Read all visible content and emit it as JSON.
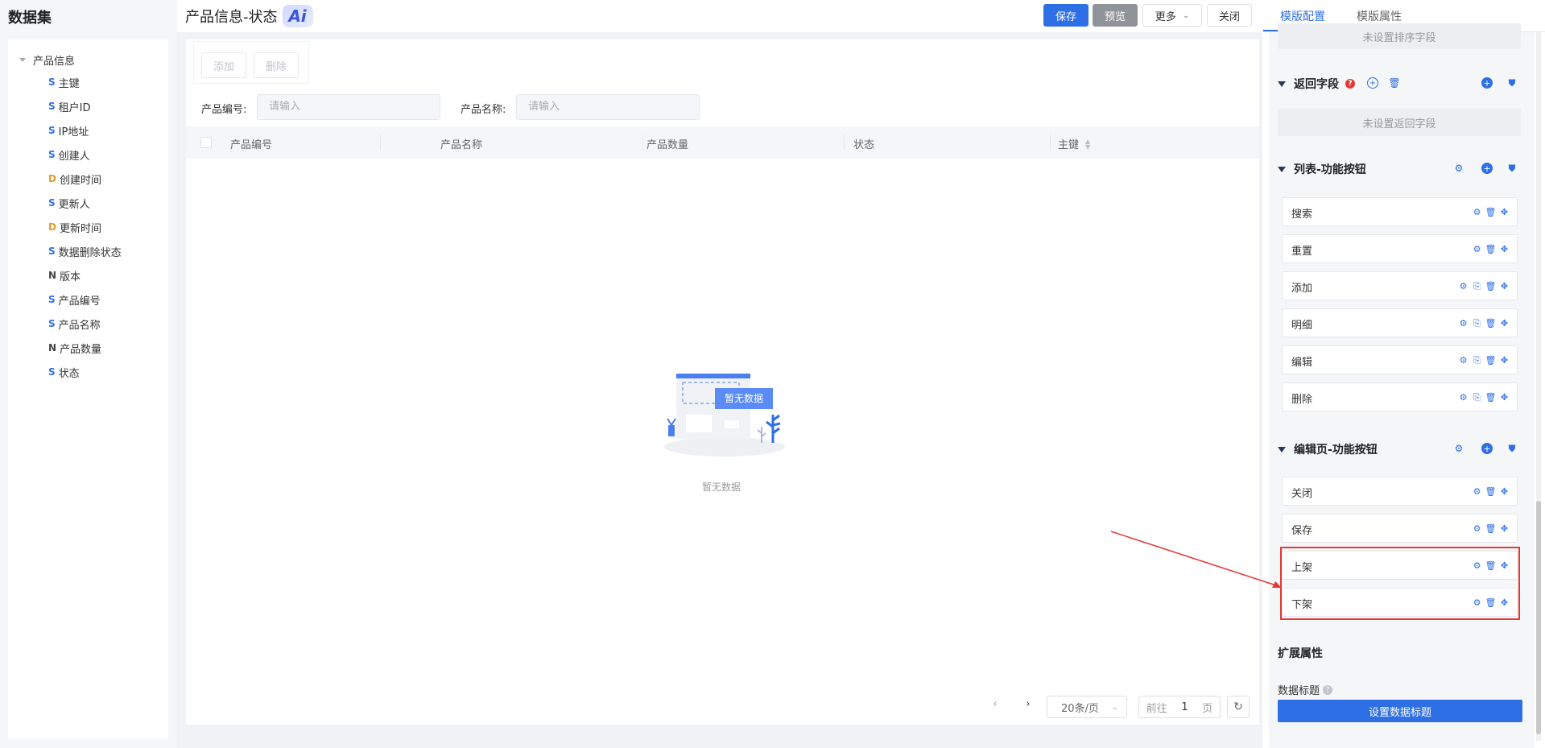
{
  "left": {
    "title": "数据集",
    "root": "产品信息",
    "fields": [
      {
        "type": "S",
        "name": "主键"
      },
      {
        "type": "S",
        "name": "租户ID"
      },
      {
        "type": "S",
        "name": "IP地址"
      },
      {
        "type": "S",
        "name": "创建人"
      },
      {
        "type": "D",
        "name": "创建时间"
      },
      {
        "type": "S",
        "name": "更新人"
      },
      {
        "type": "D",
        "name": "更新时间"
      },
      {
        "type": "S",
        "name": "数据删除状态"
      },
      {
        "type": "N",
        "name": "版本"
      },
      {
        "type": "S",
        "name": "产品编号"
      },
      {
        "type": "S",
        "name": "产品名称"
      },
      {
        "type": "N",
        "name": "产品数量"
      },
      {
        "type": "S",
        "name": "状态"
      }
    ]
  },
  "header": {
    "title": "产品信息-状态",
    "ai_badge": "Ai",
    "save": "保存",
    "preview": "预览",
    "more": "更多",
    "close": "关闭"
  },
  "main": {
    "add": "添加",
    "delete": "删除",
    "filters": [
      {
        "label": "产品编号:",
        "placeholder": "请输入"
      },
      {
        "label": "产品名称:",
        "placeholder": "请输入"
      }
    ],
    "columns": [
      "产品编号",
      "产品名称",
      "产品数量",
      "状态",
      "主键"
    ],
    "empty_badge": "暂无数据",
    "empty_text": "暂无数据",
    "pager": {
      "page_size": "20条/页",
      "goto_prefix": "前往",
      "page": "1",
      "goto_suffix": "页"
    }
  },
  "right": {
    "tabs": [
      "模版配置",
      "模版属性"
    ],
    "sort_placeholder": "未设置排序字段",
    "return_fields": {
      "title": "返回字段",
      "placeholder": "未设置返回字段"
    },
    "list_buttons": {
      "title": "列表-功能按钮",
      "items": [
        "搜索",
        "重置",
        "添加",
        "明细",
        "编辑",
        "删除"
      ]
    },
    "edit_buttons": {
      "title": "编辑页-功能按钮",
      "items": [
        "关闭",
        "保存",
        "上架",
        "下架"
      ]
    },
    "ext": {
      "title": "扩展属性",
      "data_title_label": "数据标题",
      "set_button": "设置数据标题"
    }
  }
}
